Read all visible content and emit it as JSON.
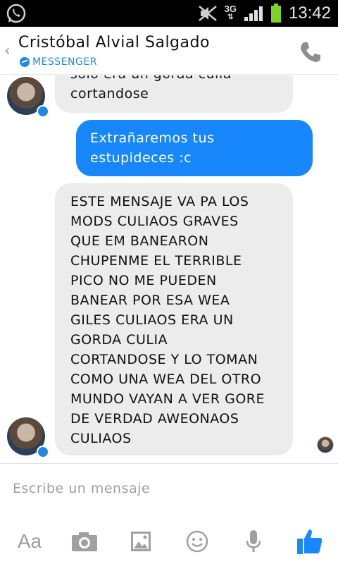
{
  "status_bar": {
    "network": "3G",
    "time": "13:42"
  },
  "header": {
    "title": "Cristóbal Alvial Salgado",
    "subtitle": "MESSENGER"
  },
  "messages": [
    {
      "direction": "in",
      "text": "solo era un gorda culia cortandose"
    },
    {
      "direction": "out",
      "text": "Extrañaremos tus estupideces :c"
    },
    {
      "direction": "in",
      "text": "ESTE MENSAJE VA PA LOS MODS CULIAOS GRAVES QUE EM BANEARON CHUPENME EL TERRIBLE PICO NO ME PUEDEN BANEAR POR ESA WEA GILES CULIAOS ERA UN GORDA CULIA CORTANDOSE Y LO TOMAN COMO UNA WEA DEL OTRO MUNDO VAYAN A VER GORE DE VERDAD AWEONAOS CULIAOS"
    }
  ],
  "messages_display": {
    "m0_line1": "solo era un gorda culia",
    "m0_line2": "cortandose",
    "m1_line1": "Extrañaremos tus",
    "m1_line2": "estupideces :c",
    "m2_lines": [
      "ESTE MENSAJE VA PA LOS",
      "MODS CULIAOS GRAVES",
      "QUE EM BANEARON",
      "CHUPENME EL TERRIBLE",
      "PICO NO ME PUEDEN",
      "BANEAR POR ESA WEA",
      "GILES CULIAOS ERA UN",
      "GORDA CULIA",
      "CORTANDOSE Y LO TOMAN",
      "COMO UNA WEA DEL OTRO",
      "MUNDO VAYAN A VER GORE",
      "DE VERDAD AWEONAOS",
      "CULIAOS"
    ]
  },
  "composer": {
    "placeholder": "Escribe un mensaje",
    "font_button": "Aa"
  },
  "colors": {
    "accent": "#1e88e5",
    "outgoing_bubble": "#1787fb",
    "incoming_bubble": "#ececec",
    "icon_gray": "#9e9e9e"
  },
  "icons": [
    "whatsapp-icon",
    "mute-icon",
    "signal-icon",
    "battery-icon",
    "back-icon",
    "phone-icon",
    "camera-icon",
    "gallery-icon",
    "emoji-icon",
    "mic-icon",
    "like-icon"
  ]
}
